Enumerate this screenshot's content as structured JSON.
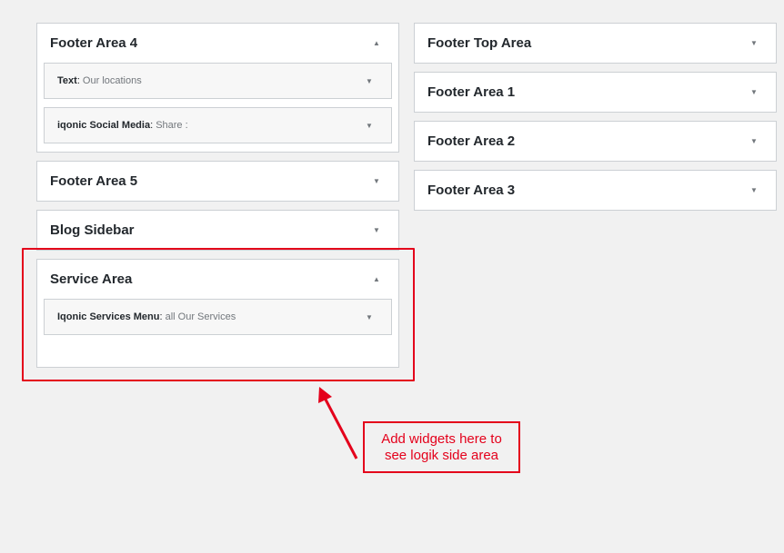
{
  "left_column": [
    {
      "id": "footer-area-4",
      "title": "Footer Area 4",
      "toggle": "▲",
      "widgets": [
        {
          "name": "Text",
          "sep": ":",
          "title": " Our locations",
          "toggle": "▼"
        },
        {
          "name": "iqonic Social Media",
          "sep": ":",
          "title": " Share :",
          "toggle": "▼"
        }
      ]
    },
    {
      "id": "footer-area-5",
      "title": "Footer Area 5",
      "toggle": "▼"
    },
    {
      "id": "blog-sidebar",
      "title": "Blog Sidebar",
      "toggle": "▼"
    },
    {
      "id": "service-area",
      "title": "Service Area",
      "toggle": "▲",
      "widgets": [
        {
          "name": "Iqonic Services Menu",
          "sep": ":",
          "title": " all Our Services",
          "toggle": "▼"
        }
      ]
    }
  ],
  "right_column": [
    {
      "id": "footer-top-area",
      "title": "Footer Top Area",
      "toggle": "▼"
    },
    {
      "id": "footer-area-1",
      "title": "Footer Area 1",
      "toggle": "▼"
    },
    {
      "id": "footer-area-2",
      "title": "Footer Area 2",
      "toggle": "▼"
    },
    {
      "id": "footer-area-3",
      "title": "Footer Area 3",
      "toggle": "▼"
    }
  ],
  "annotation": {
    "text": "Add widgets here to see logik side area",
    "color": "#e4001b"
  }
}
